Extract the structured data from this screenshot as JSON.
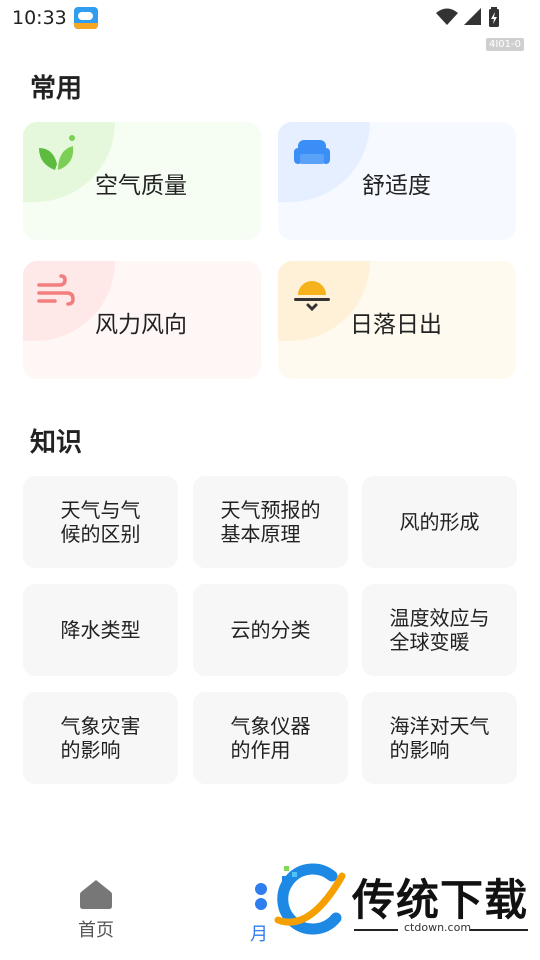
{
  "status_bar": {
    "time": "10:33",
    "build_tag": "4I01-0"
  },
  "sections": {
    "common": "常用",
    "knowledge": "知识"
  },
  "features": [
    {
      "label": "空气质量",
      "icon": "leaf-icon"
    },
    {
      "label": "舒适度",
      "icon": "sofa-icon"
    },
    {
      "label": "风力风向",
      "icon": "wind-icon"
    },
    {
      "label": "日落日出",
      "icon": "sunset-icon"
    }
  ],
  "knowledge": [
    {
      "label": "天气与气\n候的区别"
    },
    {
      "label": "天气预报的\n基本原理"
    },
    {
      "label": "风的形成"
    },
    {
      "label": "降水类型"
    },
    {
      "label": "云的分类"
    },
    {
      "label": "温度效应与\n全球变暖"
    },
    {
      "label": "气象灾害\n的影响"
    },
    {
      "label": "气象仪器\n的作用"
    },
    {
      "label": "海洋对天气\n的影响"
    }
  ],
  "bottom_nav": {
    "home_label": "首页",
    "second_label_partial": "月"
  },
  "watermark": {
    "title": "传统下载",
    "url": "ctdown.com"
  },
  "colors": {
    "accent": "#2f7ef0",
    "air": "#5dbb3f",
    "comfort": "#3b8ef5",
    "wind": "#f27d7d",
    "sun": "#f6b21a"
  }
}
